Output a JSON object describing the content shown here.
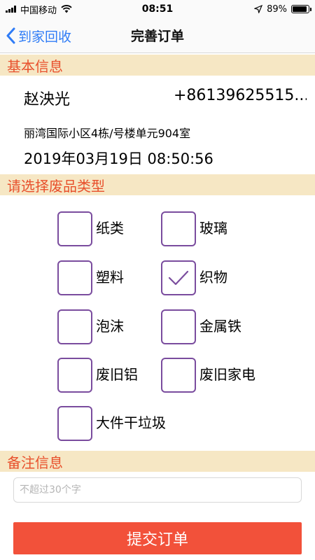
{
  "status_bar": {
    "carrier": "中国移动",
    "time": "08:51",
    "battery": "89%",
    "battery_level": 0.89
  },
  "nav": {
    "back_label": "到家回收",
    "title": "完善订单"
  },
  "basic_info": {
    "header": "基本信息",
    "name": "赵泱光",
    "phone": "+86139625515...",
    "address": "丽湾国际小区4栋/号楼单元904室",
    "datetime": "2019年03月19日 08:50:56"
  },
  "waste_types": {
    "header": "请选择废品类型",
    "items": [
      {
        "label": "纸类",
        "checked": false
      },
      {
        "label": "玻璃",
        "checked": false
      },
      {
        "label": "塑料",
        "checked": false
      },
      {
        "label": "织物",
        "checked": true
      },
      {
        "label": "泡沫",
        "checked": false
      },
      {
        "label": "金属铁",
        "checked": false
      },
      {
        "label": "废旧铝",
        "checked": false
      },
      {
        "label": "废旧家电",
        "checked": false
      },
      {
        "label": "大件干垃圾",
        "checked": false
      }
    ]
  },
  "remark": {
    "header": "备注信息",
    "value": "",
    "placeholder": "不超过30个字"
  },
  "submit": {
    "label": "提交订单"
  },
  "colors": {
    "accent_red": "#e8502c",
    "section_bg": "#f6e7c4",
    "checkbox_border": "#7a4c9e",
    "submit_bg": "#f2513a",
    "nav_link": "#2f7cf6"
  }
}
